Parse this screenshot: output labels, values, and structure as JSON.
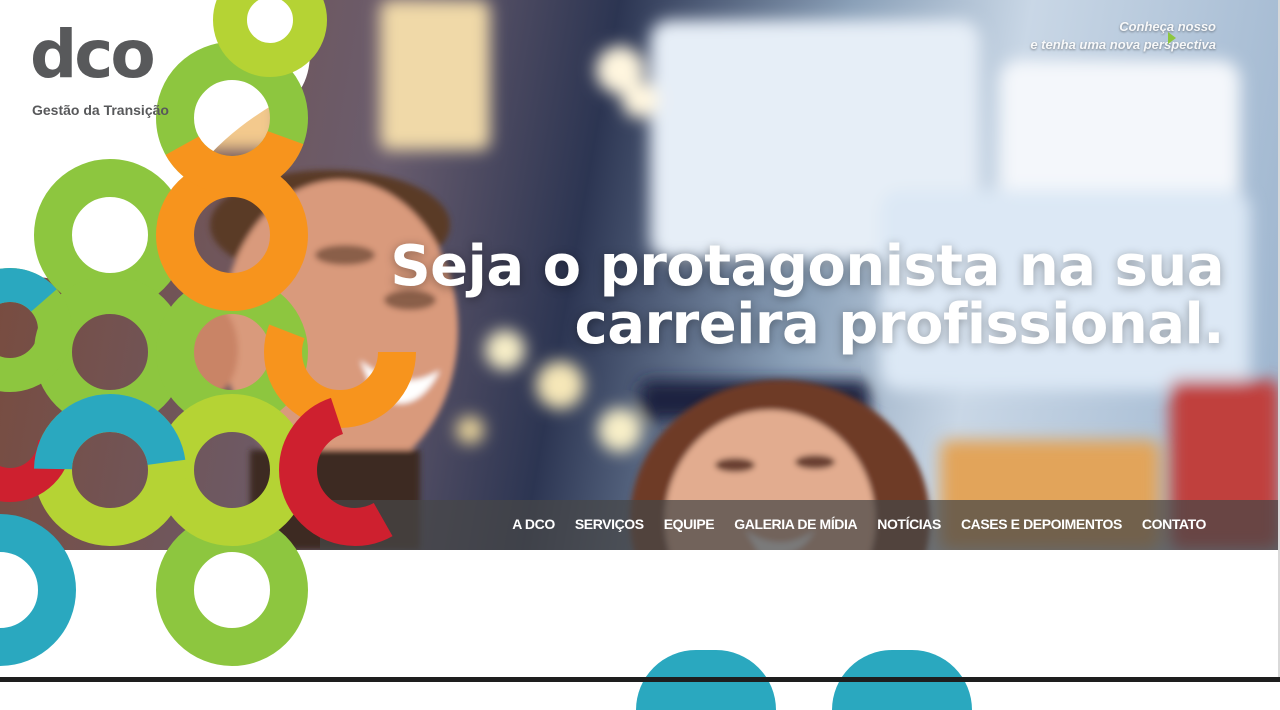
{
  "brand": {
    "logo_text": "dco",
    "tagline": "Gestão da Transição"
  },
  "hero": {
    "headline_line1": "Seja o protagonista na sua",
    "headline_line2": "carreira profissional.",
    "promo_line1": "Conheça nosso",
    "promo_line2": "e tenha uma nova perspectiva"
  },
  "nav": {
    "items": [
      {
        "label": "A DCO"
      },
      {
        "label": "SERVIÇOS"
      },
      {
        "label": "EQUIPE"
      },
      {
        "label": "GALERIA DE MÍDIA"
      },
      {
        "label": "NOTÍCIAS"
      },
      {
        "label": "CASES E DEPOIMENTOS"
      },
      {
        "label": "CONTATO"
      }
    ]
  },
  "colors": {
    "green": "#8dc63f",
    "lime": "#b5d334",
    "orange": "#f7941d",
    "red": "#ce202f",
    "teal": "#2aa8bf",
    "logo_gray": "#58595b"
  }
}
